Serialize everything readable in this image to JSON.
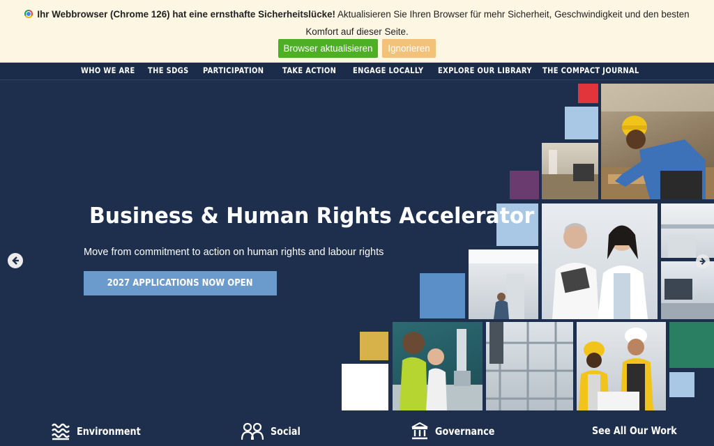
{
  "banner": {
    "bold_text": "Ihr Webbrowser (Chrome 126) hat eine ernsthafte Sicherheitslücke!",
    "text": " Aktualisieren Sie Ihren Browser für mehr Sicherheit, Geschwindigkeit und den besten Komfort auf dieser Seite.",
    "update_label": "Browser aktualisieren",
    "ignore_label": "Ignorieren"
  },
  "nav": {
    "items": [
      {
        "label": "WHO WE ARE"
      },
      {
        "label": "THE SDGS"
      },
      {
        "label": "PARTICIPATION"
      },
      {
        "label": "TAKE ACTION"
      },
      {
        "label": "ENGAGE LOCALLY"
      },
      {
        "label": "EXPLORE OUR LIBRARY"
      },
      {
        "label": "THE COMPACT JOURNAL"
      }
    ]
  },
  "hero": {
    "title": "Business & Human Rights Accelerator",
    "subtitle": "Move from commitment to action on human rights and labour rights",
    "cta_label": "2027 APPLICATIONS NOW OPEN"
  },
  "categories": [
    {
      "label": "Environment",
      "icon": "waves-icon"
    },
    {
      "label": "Social",
      "icon": "people-icon"
    },
    {
      "label": "Governance",
      "icon": "institution-icon"
    }
  ],
  "see_all_label": "See All Our Work",
  "colors": {
    "background": "#1d2f4d",
    "banner_bg": "#fdf6e3",
    "update_button": "#4caf24",
    "ignore_button": "#f2c27a",
    "cta": "#6b9bcc",
    "tile_red": "#e2353b",
    "tile_lightblue": "#a8c8e6",
    "tile_purple": "#6a3b6f",
    "tile_blue": "#5b8fc8",
    "tile_gold": "#d7b14a",
    "tile_green": "#2a7f63",
    "tile_white": "#ffffff"
  }
}
